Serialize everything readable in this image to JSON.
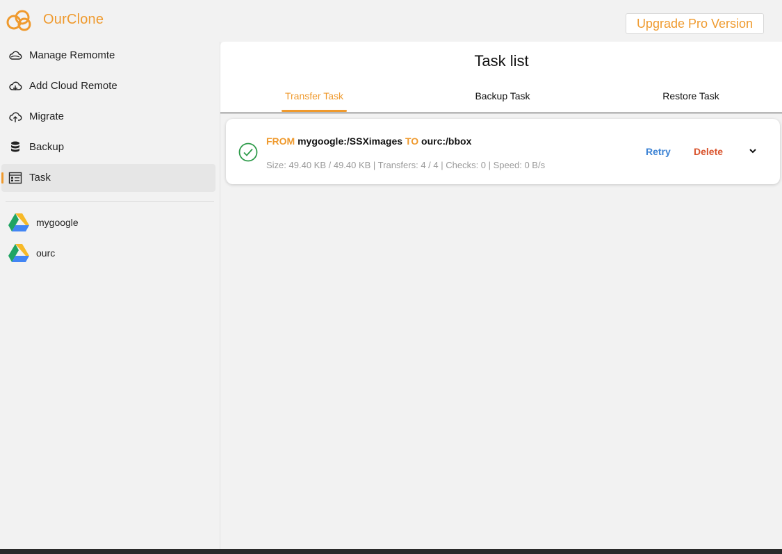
{
  "app": {
    "title": "OurClone",
    "upgrade_label": "Upgrade Pro Version",
    "accent_color": "#ef9a2e"
  },
  "sidebar": {
    "items": [
      {
        "label": "Manage Remomte",
        "icon": "cloud-icon",
        "active": false
      },
      {
        "label": "Add Cloud Remote",
        "icon": "cloud-add-icon",
        "active": false
      },
      {
        "label": "Migrate",
        "icon": "cloud-upload-icon",
        "active": false
      },
      {
        "label": "Backup",
        "icon": "database-icon",
        "active": false
      },
      {
        "label": "Task",
        "icon": "task-list-icon",
        "active": true
      }
    ],
    "remotes": [
      {
        "label": "mygoogle",
        "icon": "google-drive-icon"
      },
      {
        "label": "ourc",
        "icon": "google-drive-icon"
      }
    ]
  },
  "main": {
    "title": "Task list",
    "tabs": [
      {
        "label": "Transfer Task",
        "active": true
      },
      {
        "label": "Backup Task",
        "active": false
      },
      {
        "label": "Restore Task",
        "active": false
      }
    ],
    "tasks": [
      {
        "status": "success",
        "from_keyword": "FROM",
        "source": "mygoogle:/SSXimages",
        "to_keyword": "TO",
        "destination": "ourc:/bbox",
        "stats": "Size: 49.40 KB / 49.40 KB | Transfers: 4 / 4 | Checks: 0 | Speed: 0 B/s",
        "retry_label": "Retry",
        "delete_label": "Delete"
      }
    ]
  }
}
